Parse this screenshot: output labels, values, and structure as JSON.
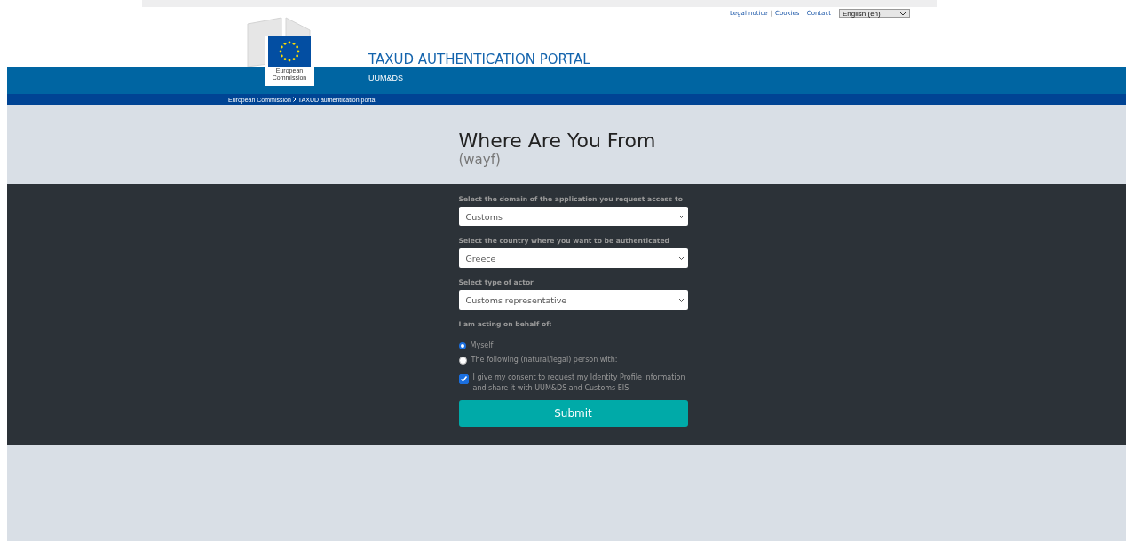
{
  "top_links": [
    "Legal notice",
    "Cookies",
    "Contact"
  ],
  "top_link_separator": "|",
  "language_select": {
    "value": "English (en)"
  },
  "logo": {
    "lines": [
      "European",
      "Commission"
    ]
  },
  "site_title": "TAXUD AUTHENTICATION PORTAL",
  "site_subtitle": "UUM&DS",
  "breadcrumb": [
    "European Commission",
    "TAXUD authentication portal"
  ],
  "page_heading": "Where Are You From",
  "page_subheading": "(wayf)",
  "form": {
    "selects": [
      {
        "label": "Select the domain of the application you request access to",
        "value": "Customs"
      },
      {
        "label": "Select the country where you want to be authenticated",
        "value": "Greece"
      },
      {
        "label": "Select type of actor",
        "value": "Customs representative"
      }
    ],
    "behalf_label": "I am acting on behalf of:",
    "radios": [
      {
        "label": "Myself",
        "selected": true
      },
      {
        "label": "The following (natural/legal) person with:",
        "selected": false
      }
    ],
    "consent": {
      "label": "I give my consent to request my Identity Profile information and share it with UUM&DS and Customs EIS",
      "checked": true
    },
    "submit": "Submit"
  }
}
